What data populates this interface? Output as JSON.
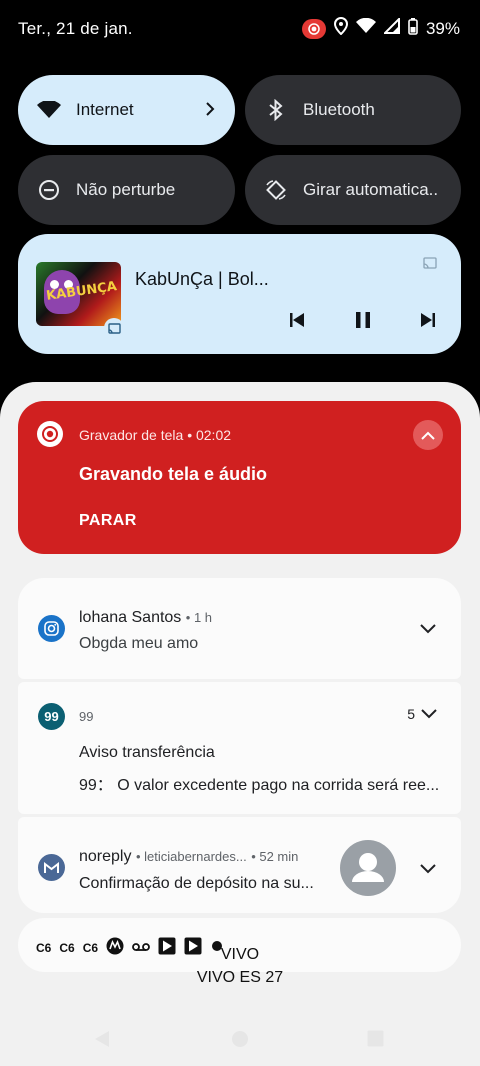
{
  "status_bar": {
    "date": "Ter., 21 de jan.",
    "battery": "39%"
  },
  "quick_tiles": [
    {
      "label": "Internet",
      "icon": "wifi-icon",
      "active": true
    },
    {
      "label": "Bluetooth",
      "icon": "bluetooth-icon",
      "active": false
    },
    {
      "label": "Não perturbe",
      "icon": "dnd-icon",
      "active": false
    },
    {
      "label": "Girar automatica..",
      "icon": "rotate-icon",
      "active": false
    }
  ],
  "media": {
    "title": "KabUnÇa | Bol...",
    "thumb_text": "KABUNÇA"
  },
  "recorder": {
    "app": "Gravador de tela",
    "time": "02:02",
    "title": "Gravando tela e áudio",
    "action": "PARAR"
  },
  "notifications": [
    {
      "app_icon": "instagram-icon",
      "sender": "lohana Santos",
      "time": "1 h",
      "body": "Obgda meu amo"
    },
    {
      "app_icon": "99-icon",
      "app_label": "99",
      "count": "5",
      "title": "Aviso transferência",
      "body": "99： O valor excedente pago na corrida será ree..."
    },
    {
      "app_icon": "mail-icon",
      "sender": "noreply",
      "account": "leticiabernardes...",
      "time": "52 min",
      "body": "Confirmação de depósito na su..."
    }
  ],
  "tray_icons": [
    "C6",
    "C6",
    "C6"
  ],
  "carrier": {
    "line1": "VIVO",
    "line2": "VIVO ES 27"
  },
  "colors": {
    "recorder_bg": "#d02020",
    "tile_active": "#d6ecfb",
    "tile_inactive": "#2e2f33"
  }
}
